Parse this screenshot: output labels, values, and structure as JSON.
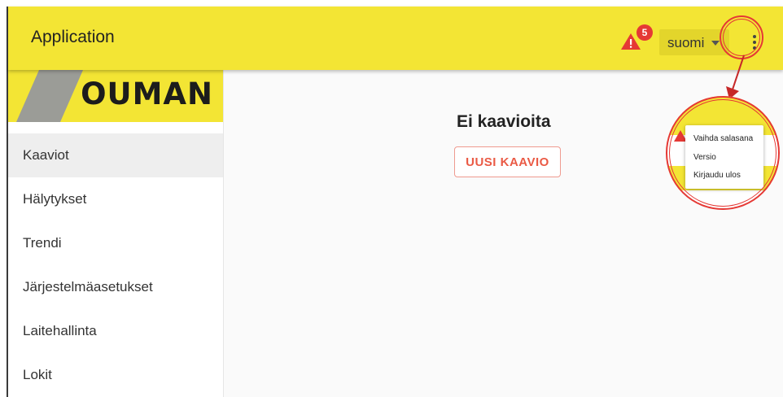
{
  "appbar": {
    "title": "Application",
    "alert_count": "5",
    "language": "suomi",
    "icons": [
      "warning-icon",
      "chevron-down-icon",
      "more-vert-icon"
    ]
  },
  "sidebar": {
    "logo": "OUMAN",
    "items": [
      {
        "label": "Kaaviot",
        "active": true
      },
      {
        "label": "Hälytykset"
      },
      {
        "label": "Trendi"
      },
      {
        "label": "Järjestelmäasetukset"
      },
      {
        "label": "Laitehallinta"
      },
      {
        "label": "Lokit"
      }
    ]
  },
  "main": {
    "empty_title": "Ei kaavioita",
    "new_chart_label": "UUSI KAAVIO"
  },
  "overflow_menu": {
    "items": [
      "Vaihda salasana",
      "Versio",
      "Kirjaudu ulos"
    ]
  },
  "colors": {
    "appbar": "#f3e534",
    "accent": "#ea5a45",
    "annotation": "#e53935"
  }
}
